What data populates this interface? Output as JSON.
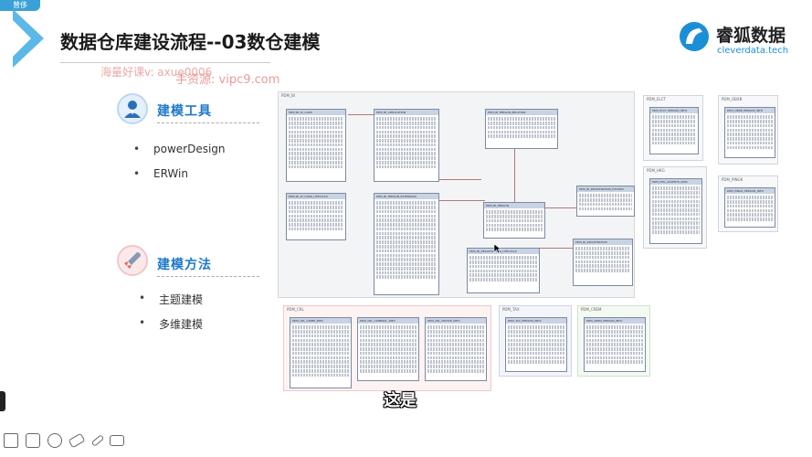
{
  "corner_tag": "曾侈",
  "slide": {
    "title": "数据仓库建设流程--03数仓建模",
    "logo": {
      "cn": "睿狐数据",
      "en": "cleverdata.tech",
      "icon": "fox-logo-icon"
    }
  },
  "watermark": {
    "line1": "海量好课v: axue0006",
    "line2": "手资源: vipc9.com"
  },
  "sections": [
    {
      "title": "建模工具",
      "icon": "user-avatar-icon",
      "items": [
        "powerDesign",
        "ERWin"
      ]
    },
    {
      "title": "建模方法",
      "icon": "rocket-icon",
      "items": [
        "主题建模",
        "多维建模"
      ]
    }
  ],
  "diagram": {
    "main_group": "PDM_BI",
    "tables": [
      "PDM_BI_ID_CARD",
      "PDM_BI_APPLICATION",
      "PDM_BI_PERSON_RELATION",
      "PDM_BI_ID_CARD_LIFECYCLE",
      "PDM_BI_PERSON_EXTENSION",
      "PDM_BI_PERSON",
      "PDM_BI_REGISTRATION_LIFECYCLE",
      "PDM_BI_REGISTRATION",
      "PDM_BI_REGISTRATION_HISTORY"
    ],
    "side_groups": [
      {
        "name": "PDM_ELCT",
        "table": "PDM_ELCT_PERSON_INFO"
      },
      {
        "name": "PDM_OBXB",
        "table": "PDM_OBXB_PERSON_INFO"
      },
      {
        "name": "PDM_HKG",
        "table": "PDM_HKG_ASSENTS_PAPA"
      },
      {
        "name": "PDM_PINGK",
        "table": "PDM_PINGK_PERSON_INFO"
      }
    ],
    "bottom_groups": [
      {
        "name": "PDM_CRL",
        "tables": [
          "PDM_CRL_CRIME_INFO",
          "PDM_CRL_CRIMINAL_INFO",
          "PDM_CRL_NOTICE_INFO"
        ]
      },
      {
        "name": "PDM_TAX",
        "tables": [
          "PDM_TAX_PERSON_INFO"
        ]
      },
      {
        "name": "PDM_CREM",
        "tables": [
          "PDM_CREM_PERSON_INFO"
        ]
      }
    ]
  },
  "subtitle": "这是",
  "toolbar": [
    "edit-icon",
    "layout-icon",
    "palette-icon",
    "eraser-icon",
    "pen-icon",
    "screen-icon"
  ]
}
